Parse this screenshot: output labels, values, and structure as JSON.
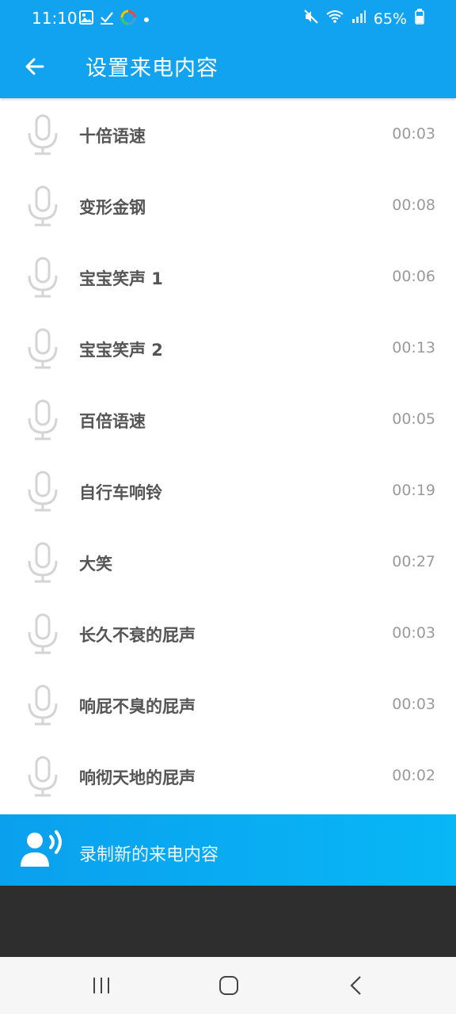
{
  "status_bar": {
    "time": "11:10",
    "battery": "65%",
    "left_icons": [
      "image-icon",
      "check-icon",
      "color-wheel-icon",
      "dot-icon"
    ],
    "right_icons": [
      "mute-icon",
      "wifi-icon",
      "signal-icon",
      "battery-icon"
    ]
  },
  "app_bar": {
    "title": "设置来电内容",
    "back_icon": "back-arrow-icon",
    "color": "#12a3f0"
  },
  "sounds": [
    {
      "name": "十倍语速",
      "duration": "00:03"
    },
    {
      "name": "变形金钢",
      "duration": "00:08"
    },
    {
      "name": "宝宝笑声 1",
      "duration": "00:06"
    },
    {
      "name": "宝宝笑声 2",
      "duration": "00:13"
    },
    {
      "name": "百倍语速",
      "duration": "00:05"
    },
    {
      "name": "自行车响铃",
      "duration": "00:19"
    },
    {
      "name": "大笑",
      "duration": "00:27"
    },
    {
      "name": "长久不衰的屁声",
      "duration": "00:03"
    },
    {
      "name": "响屁不臭的屁声",
      "duration": "00:03"
    },
    {
      "name": "响彻天地的屁声",
      "duration": "00:02"
    }
  ],
  "record_bar": {
    "label": "录制新的来电内容",
    "icon": "record-voice-icon"
  },
  "nav_bar": {
    "icons": [
      "recents-icon",
      "home-icon",
      "back-icon"
    ]
  }
}
